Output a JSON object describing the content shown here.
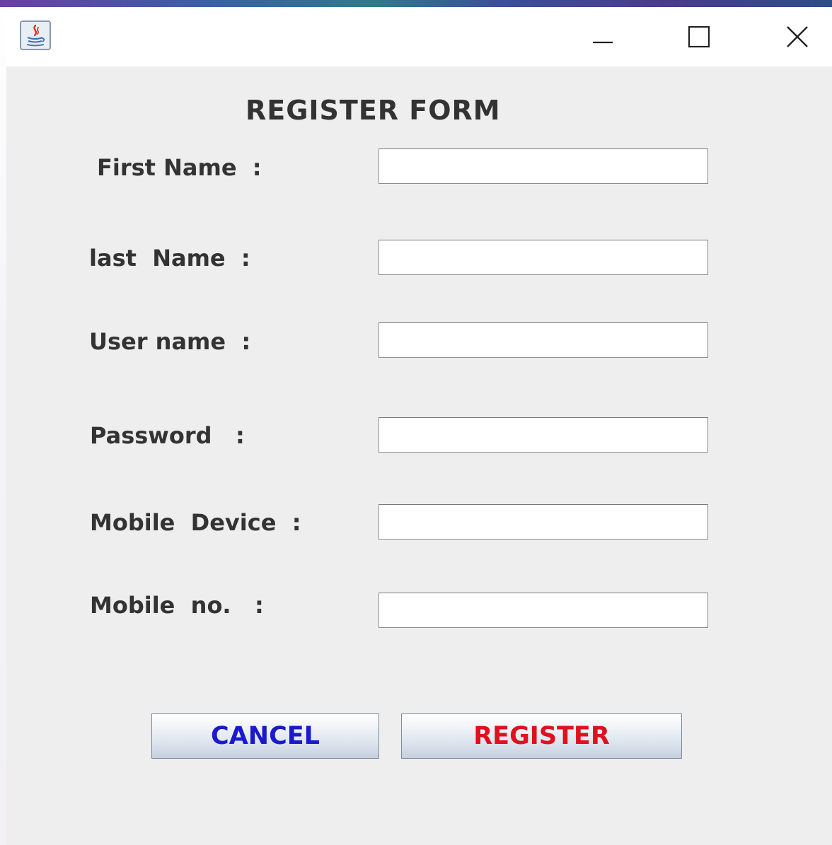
{
  "window": {
    "app_icon": "java-coffee-icon",
    "controls": {
      "minimize_icon": "minimize-icon",
      "maximize_icon": "maximize-icon",
      "close_icon": "close-icon"
    }
  },
  "form": {
    "title": "REGISTER  FORM",
    "fields": [
      {
        "label": "First Name  :",
        "value": ""
      },
      {
        "label": "last  Name  :",
        "value": ""
      },
      {
        "label": "User name  :",
        "value": ""
      },
      {
        "label": "Password   :",
        "value": ""
      },
      {
        "label": "Mobile  Device  :",
        "value": ""
      },
      {
        "label": "Mobile  no.   :",
        "value": ""
      }
    ]
  },
  "buttons": {
    "cancel_label": "CANCEL",
    "register_label": "REGISTER"
  },
  "colors": {
    "cancel_text": "#1a1acc",
    "register_text": "#e0101e",
    "panel_background": "#eeeeee"
  }
}
